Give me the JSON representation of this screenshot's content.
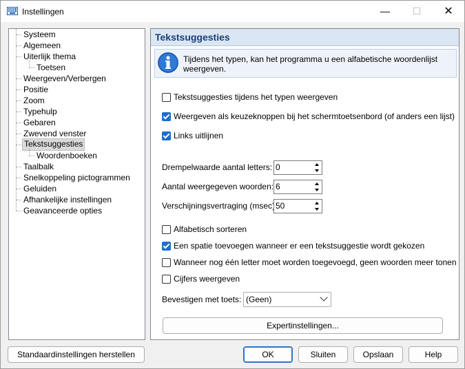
{
  "window": {
    "title": "Instellingen",
    "controls": {
      "minimize": "—",
      "maximize": "☐",
      "close": "✕"
    }
  },
  "tree": {
    "items": [
      {
        "label": "Systeem",
        "level": 0
      },
      {
        "label": "Algemeen",
        "level": 0
      },
      {
        "label": "Uiterlijk thema",
        "level": 0
      },
      {
        "label": "Toetsen",
        "level": 1
      },
      {
        "label": "Weergeven/Verbergen",
        "level": 0
      },
      {
        "label": "Positie",
        "level": 0
      },
      {
        "label": "Zoom",
        "level": 0
      },
      {
        "label": "Typehulp",
        "level": 0
      },
      {
        "label": "Gebaren",
        "level": 0
      },
      {
        "label": "Zwevend venster",
        "level": 0
      },
      {
        "label": "Tekstsuggesties",
        "level": 0,
        "selected": true
      },
      {
        "label": "Woordenboeken",
        "level": 1
      },
      {
        "label": "Taalbalk",
        "level": 0
      },
      {
        "label": "Snelkoppeling pictogrammen",
        "level": 0
      },
      {
        "label": "Geluiden",
        "level": 0
      },
      {
        "label": "Afhankelijke instellingen",
        "level": 0
      },
      {
        "label": "Geavanceerde opties",
        "level": 0
      }
    ]
  },
  "panel": {
    "title": "Tekstsuggesties",
    "info": "Tijdens het typen, kan het programma u een alfabetische woordenlijst weergeven.",
    "options_top": [
      {
        "label": "Tekstsuggesties tijdens het typen weergeven",
        "checked": false
      },
      {
        "label": "Weergeven als keuzeknoppen bij het schermtoetsenbord (of anders een lijst)",
        "checked": true
      },
      {
        "label": "Links uitlijnen",
        "checked": true
      }
    ],
    "spinners": [
      {
        "label": "Drempelwaarde aantal letters:",
        "value": "0"
      },
      {
        "label": "Aantal weergegeven woorden:",
        "value": "6"
      },
      {
        "label": "Verschijningsvertraging (msec):",
        "value": "50"
      }
    ],
    "options_bottom": [
      {
        "label": "Alfabetisch sorteren",
        "checked": false
      },
      {
        "label": "Een spatie toevoegen wanneer er een tekstsuggestie wordt gekozen",
        "checked": true
      },
      {
        "label": "Wanneer nog één letter moet worden toegevoegd, geen woorden meer tonen",
        "checked": false
      },
      {
        "label": "Cijfers weergeven",
        "checked": false
      }
    ],
    "confirm": {
      "label": "Bevestigen met toets:",
      "value": "(Geen)"
    },
    "expert_button": "Expertinstellingen..."
  },
  "footer": {
    "restore_defaults": "Standaardinstellingen herstellen",
    "ok": "OK",
    "close": "Sluiten",
    "save": "Opslaan",
    "help": "Help"
  },
  "colors": {
    "accent": "#1a6fd0",
    "header_bg": "#dbe6f4",
    "title_text": "#1a3e78"
  }
}
